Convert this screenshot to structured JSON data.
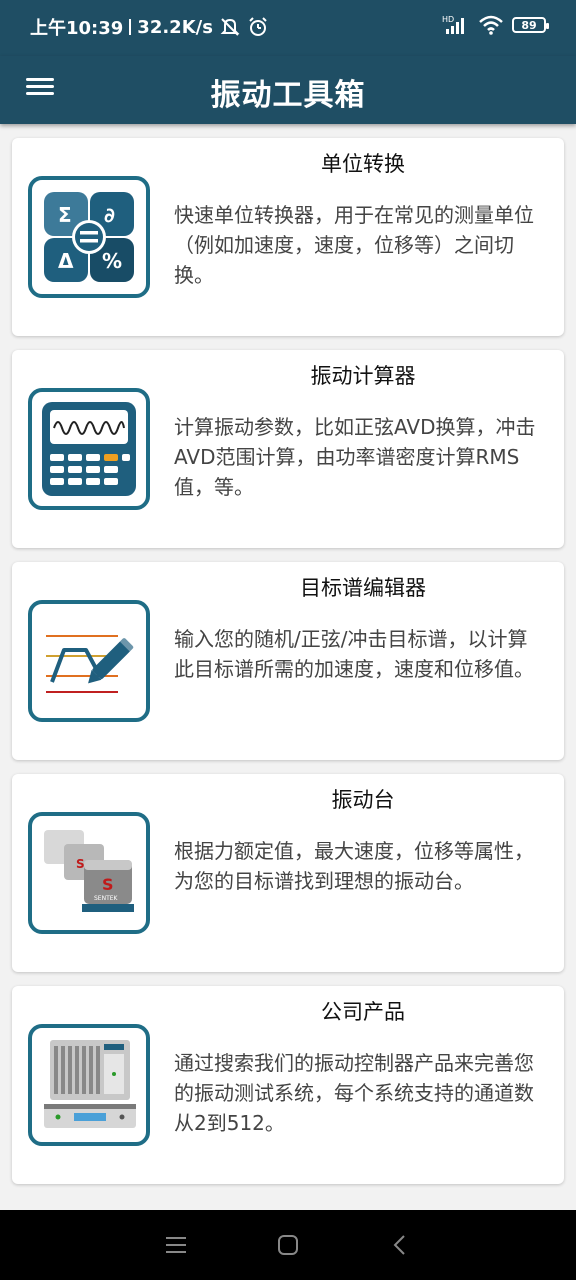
{
  "status": {
    "time": "上午10:39",
    "speed": "32.2K/s",
    "battery": "89",
    "network_label": "HD",
    "icons": [
      "mute-icon",
      "alarm-icon",
      "signal-icon",
      "wifi-icon",
      "battery-icon"
    ]
  },
  "appbar": {
    "title": "振动工具箱",
    "menu_icon": "hamburger-menu-icon"
  },
  "cards": [
    {
      "title": "单位转换",
      "desc": "快速单位转换器，用于在常见的测量单位（例如加速度，速度，位移等）之间切换。",
      "icon": "unit-converter-icon"
    },
    {
      "title": "振动计算器",
      "desc": "计算振动参数，比如正弦AVD换算，冲击AVD范围计算，由功率谱密度计算RMS值，等。",
      "icon": "calculator-icon"
    },
    {
      "title": "目标谱编辑器",
      "desc": "输入您的随机/正弦/冲击目标谱，以计算此目标谱所需的加速度，速度和位移值。",
      "icon": "spectrum-editor-icon"
    },
    {
      "title": "振动台",
      "desc": "根据力额定值，最大速度，位移等属性，为您的目标谱找到理想的振动台。",
      "icon": "shaker-icon",
      "brand": "SENTEK"
    },
    {
      "title": "公司产品",
      "desc": "通过搜索我们的振动控制器产品来完善您的振动测试系统，每个系统支持的通道数从2到512。",
      "icon": "controller-products-icon"
    }
  ],
  "nav": {
    "icons": [
      "recent-apps-icon",
      "home-icon",
      "back-icon"
    ]
  },
  "colors": {
    "primary": "#1f4e64",
    "icon_border": "#1f6d86"
  }
}
